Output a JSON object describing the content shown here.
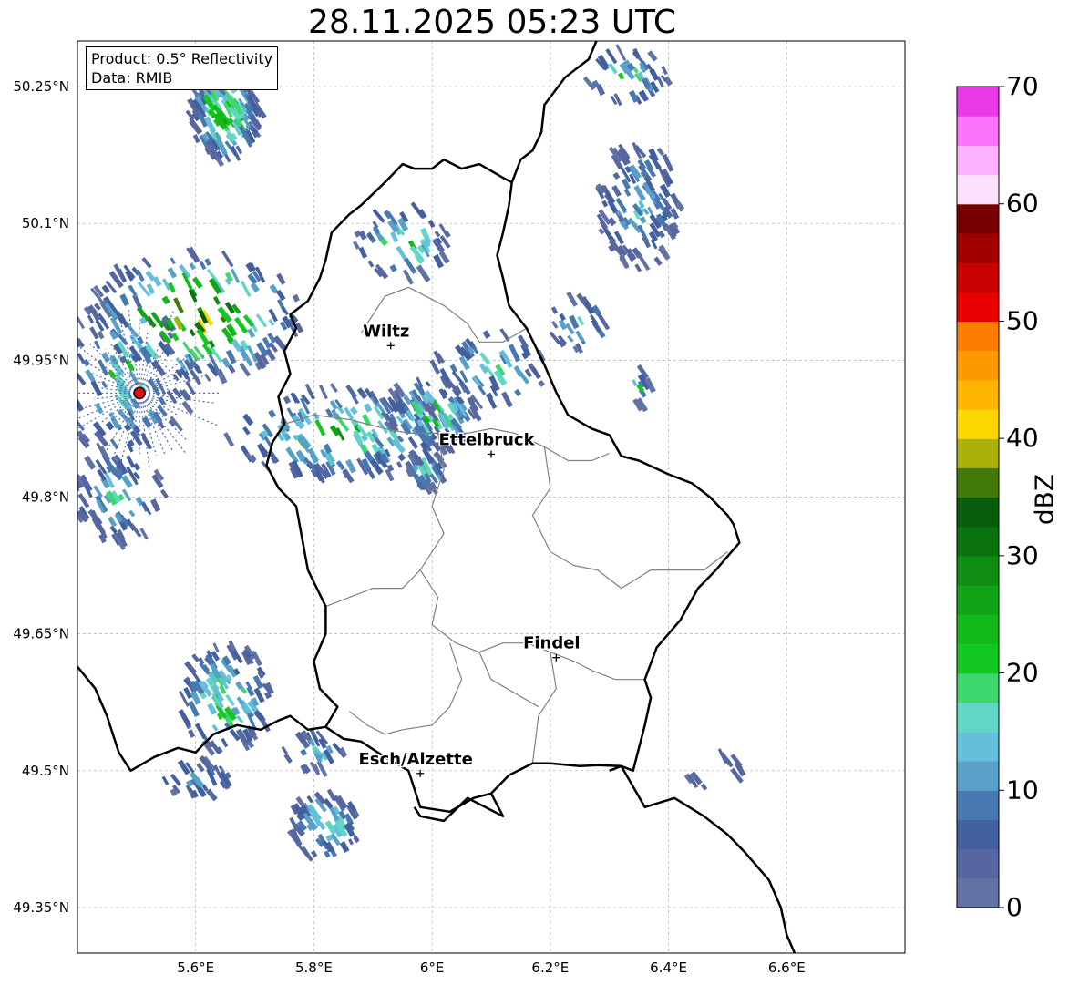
{
  "title": "28.11.2025 05:23 UTC",
  "info": {
    "product": "Product: 0.5° Reflectivity",
    "data_source": "Data: RMIB"
  },
  "colorbar": {
    "label": "dBZ",
    "tick_labels": [
      "0",
      "10",
      "20",
      "30",
      "40",
      "50",
      "60",
      "70"
    ],
    "min": 0,
    "max": 70,
    "step": 2.5,
    "colors": [
      "#6272a4",
      "#5566a0",
      "#43609e",
      "#4878b0",
      "#58a0c8",
      "#64c0da",
      "#60d6c4",
      "#3ed66e",
      "#12c820",
      "#12b818",
      "#10a416",
      "#0f8c12",
      "#0c7210",
      "#095c0c",
      "#427808",
      "#acb00a",
      "#fcd600",
      "#fcb400",
      "#fc9800",
      "#fc7c00",
      "#e80000",
      "#c80000",
      "#a00000",
      "#780000",
      "#fde0fd",
      "#fcb2fc",
      "#fa74fa",
      "#ea3ae8"
    ]
  },
  "axes": {
    "lon_range": [
      5.4,
      6.8
    ],
    "lat_range": [
      49.3,
      50.3
    ],
    "x_ticks": [
      {
        "value": 5.6,
        "label": "5.6°E"
      },
      {
        "value": 5.8,
        "label": "5.8°E"
      },
      {
        "value": 6.0,
        "label": "6°E"
      },
      {
        "value": 6.2,
        "label": "6.2°E"
      },
      {
        "value": 6.4,
        "label": "6.4°E"
      },
      {
        "value": 6.6,
        "label": "6.6°E"
      }
    ],
    "y_ticks": [
      {
        "value": 50.25,
        "label": "50.25°N"
      },
      {
        "value": 50.1,
        "label": "50.1°N"
      },
      {
        "value": 49.95,
        "label": "49.95°N"
      },
      {
        "value": 49.8,
        "label": "49.8°N"
      },
      {
        "value": 49.65,
        "label": "49.65°N"
      },
      {
        "value": 49.5,
        "label": "49.5°N"
      },
      {
        "value": 49.35,
        "label": "49.35°N"
      }
    ],
    "grid": true
  },
  "cities": [
    {
      "name": "Wiltz",
      "lon": 5.93,
      "lat": 49.966
    },
    {
      "name": "Ettelbruck",
      "lon": 6.1,
      "lat": 49.847
    },
    {
      "name": "Findel",
      "lon": 6.21,
      "lat": 49.624
    },
    {
      "name": "Esch/Alzette",
      "lon": 5.98,
      "lat": 49.497
    }
  ],
  "radar_site": {
    "lon": 5.505,
    "lat": 49.914,
    "color": "#e01010"
  },
  "echo_clusters": [
    {
      "lon": 5.65,
      "lat": 50.22,
      "rx": 0.06,
      "ry": 0.05,
      "n": 140,
      "maxdbz": 32
    },
    {
      "lon": 5.48,
      "lat": 49.93,
      "rx": 0.12,
      "ry": 0.09,
      "n": 120,
      "maxdbz": 20
    },
    {
      "lon": 5.6,
      "lat": 50.0,
      "rx": 0.18,
      "ry": 0.07,
      "n": 160,
      "maxdbz": 45
    },
    {
      "lon": 5.85,
      "lat": 49.87,
      "rx": 0.2,
      "ry": 0.05,
      "n": 170,
      "maxdbz": 26
    },
    {
      "lon": 6.0,
      "lat": 49.89,
      "rx": 0.08,
      "ry": 0.04,
      "n": 90,
      "maxdbz": 25
    },
    {
      "lon": 5.99,
      "lat": 49.83,
      "rx": 0.03,
      "ry": 0.02,
      "n": 40,
      "maxdbz": 22
    },
    {
      "lon": 6.35,
      "lat": 50.12,
      "rx": 0.07,
      "ry": 0.07,
      "n": 120,
      "maxdbz": 15
    },
    {
      "lon": 5.65,
      "lat": 49.58,
      "rx": 0.08,
      "ry": 0.06,
      "n": 110,
      "maxdbz": 26
    },
    {
      "lon": 5.82,
      "lat": 49.44,
      "rx": 0.06,
      "ry": 0.04,
      "n": 60,
      "maxdbz": 24
    },
    {
      "lon": 5.47,
      "lat": 49.8,
      "rx": 0.08,
      "ry": 0.05,
      "n": 70,
      "maxdbz": 16
    },
    {
      "lon": 5.95,
      "lat": 50.08,
      "rx": 0.08,
      "ry": 0.04,
      "n": 50,
      "maxdbz": 26
    },
    {
      "lon": 6.1,
      "lat": 49.94,
      "rx": 0.1,
      "ry": 0.04,
      "n": 50,
      "maxdbz": 20
    },
    {
      "lon": 6.33,
      "lat": 50.26,
      "rx": 0.07,
      "ry": 0.03,
      "n": 40,
      "maxdbz": 22
    },
    {
      "lon": 6.25,
      "lat": 49.99,
      "rx": 0.05,
      "ry": 0.03,
      "n": 25,
      "maxdbz": 17
    },
    {
      "lon": 5.8,
      "lat": 49.52,
      "rx": 0.05,
      "ry": 0.02,
      "n": 25,
      "maxdbz": 18
    },
    {
      "lon": 6.48,
      "lat": 49.5,
      "rx": 0.05,
      "ry": 0.02,
      "n": 12,
      "maxdbz": 12
    },
    {
      "lon": 5.6,
      "lat": 49.49,
      "rx": 0.06,
      "ry": 0.02,
      "n": 30,
      "maxdbz": 16
    },
    {
      "lon": 6.35,
      "lat": 49.92,
      "rx": 0.02,
      "ry": 0.02,
      "n": 10,
      "maxdbz": 20
    }
  ],
  "borders": {
    "national": [
      [
        [
          5.4,
          49.614
        ],
        [
          5.43,
          49.59
        ],
        [
          5.45,
          49.56
        ],
        [
          5.47,
          49.52
        ],
        [
          5.49,
          49.5
        ],
        [
          5.53,
          49.515
        ],
        [
          5.57,
          49.525
        ],
        [
          5.6,
          49.52
        ],
        [
          5.63,
          49.54
        ],
        [
          5.67,
          49.55
        ],
        [
          5.71,
          49.545
        ],
        [
          5.74,
          49.555
        ],
        [
          5.76,
          49.56
        ],
        [
          5.79,
          49.545
        ],
        [
          5.82,
          49.548
        ],
        [
          5.85,
          49.535
        ],
        [
          5.88,
          49.532
        ],
        [
          5.92,
          49.515
        ],
        [
          5.96,
          49.5
        ],
        [
          5.98,
          49.46
        ],
        [
          6.03,
          49.455
        ],
        [
          6.07,
          49.47
        ],
        [
          6.1,
          49.475
        ],
        [
          6.13,
          49.495
        ],
        [
          6.17,
          49.508
        ],
        [
          6.2,
          49.508
        ],
        [
          6.25,
          49.505
        ],
        [
          6.28,
          49.506
        ],
        [
          6.32,
          49.505
        ],
        [
          6.36,
          49.46
        ],
        [
          6.41,
          49.47
        ],
        [
          6.46,
          49.45
        ],
        [
          6.5,
          49.43
        ],
        [
          6.53,
          49.41
        ],
        [
          6.57,
          49.38
        ],
        [
          6.59,
          49.35
        ],
        [
          6.6,
          49.32
        ],
        [
          6.62,
          49.29
        ]
      ],
      [
        [
          6.28,
          50.303
        ],
        [
          6.265,
          50.28
        ],
        [
          6.225,
          50.26
        ],
        [
          6.19,
          50.23
        ],
        [
          6.185,
          50.2
        ],
        [
          6.17,
          50.18
        ],
        [
          6.15,
          50.17
        ],
        [
          6.135,
          50.145
        ],
        [
          6.13,
          50.12
        ],
        [
          6.12,
          50.09
        ],
        [
          6.11,
          50.065
        ],
        [
          6.12,
          50.04
        ],
        [
          6.13,
          50.01
        ],
        [
          6.16,
          49.985
        ],
        [
          6.19,
          49.945
        ],
        [
          6.21,
          49.915
        ],
        [
          6.23,
          49.89
        ],
        [
          6.27,
          49.875
        ],
        [
          6.3,
          49.868
        ],
        [
          6.32,
          49.845
        ],
        [
          6.35,
          49.84
        ],
        [
          6.4,
          49.825
        ],
        [
          6.44,
          49.815
        ],
        [
          6.47,
          49.8
        ],
        [
          6.5,
          49.78
        ],
        [
          6.51,
          49.77
        ],
        [
          6.52,
          49.75
        ],
        [
          6.5,
          49.735
        ],
        [
          6.48,
          49.72
        ],
        [
          6.45,
          49.7
        ],
        [
          6.42,
          49.665
        ],
        [
          6.38,
          49.635
        ],
        [
          6.36,
          49.6
        ],
        [
          6.37,
          49.58
        ],
        [
          6.36,
          49.55
        ],
        [
          6.35,
          49.525
        ],
        [
          6.34,
          49.5
        ],
        [
          6.32,
          49.505
        ],
        [
          6.3,
          49.5
        ]
      ],
      [
        [
          6.1,
          49.475
        ],
        [
          6.12,
          49.45
        ],
        [
          6.06,
          49.47
        ],
        [
          6.02,
          49.445
        ],
        [
          5.98,
          49.45
        ],
        [
          5.97,
          49.46
        ]
      ]
    ],
    "luxembourg": [
      [
        [
          5.82,
          49.548
        ],
        [
          5.84,
          49.57
        ],
        [
          5.81,
          49.59
        ],
        [
          5.8,
          49.62
        ],
        [
          5.82,
          49.65
        ],
        [
          5.82,
          49.68
        ],
        [
          5.79,
          49.72
        ],
        [
          5.77,
          49.79
        ],
        [
          5.74,
          49.81
        ],
        [
          5.72,
          49.835
        ],
        [
          5.73,
          49.86
        ],
        [
          5.75,
          49.88
        ],
        [
          5.74,
          49.91
        ],
        [
          5.76,
          49.935
        ],
        [
          5.75,
          49.96
        ],
        [
          5.77,
          49.985
        ],
        [
          5.76,
          50.0
        ],
        [
          5.79,
          50.015
        ],
        [
          5.81,
          50.04
        ],
        [
          5.82,
          50.06
        ],
        [
          5.83,
          50.09
        ],
        [
          5.86,
          50.11
        ],
        [
          5.88,
          50.12
        ],
        [
          5.92,
          50.145
        ],
        [
          5.95,
          50.165
        ],
        [
          5.97,
          50.16
        ],
        [
          6.0,
          50.16
        ],
        [
          6.02,
          50.17
        ],
        [
          6.05,
          50.16
        ],
        [
          6.08,
          50.165
        ],
        [
          6.12,
          50.15
        ],
        [
          6.135,
          50.145
        ]
      ]
    ],
    "cantons": [
      [
        [
          5.88,
          49.98
        ],
        [
          5.92,
          50.02
        ],
        [
          5.96,
          50.03
        ],
        [
          6.02,
          50.01
        ],
        [
          6.06,
          49.99
        ],
        [
          6.08,
          49.97
        ],
        [
          6.12,
          49.97
        ],
        [
          6.16,
          49.985
        ]
      ],
      [
        [
          5.75,
          49.88
        ],
        [
          5.8,
          49.89
        ],
        [
          5.86,
          49.885
        ],
        [
          5.92,
          49.875
        ],
        [
          5.96,
          49.87
        ],
        [
          6.01,
          49.87
        ],
        [
          6.06,
          49.87
        ],
        [
          6.1,
          49.875
        ],
        [
          6.14,
          49.87
        ],
        [
          6.19,
          49.855
        ],
        [
          6.23,
          49.84
        ],
        [
          6.27,
          49.84
        ],
        [
          6.3,
          49.848
        ]
      ],
      [
        [
          6.01,
          49.87
        ],
        [
          6.02,
          49.83
        ],
        [
          6.0,
          49.79
        ],
        [
          6.02,
          49.76
        ],
        [
          5.98,
          49.72
        ],
        [
          6.01,
          49.69
        ],
        [
          6.0,
          49.66
        ],
        [
          6.04,
          49.64
        ],
        [
          6.08,
          49.63
        ],
        [
          6.12,
          49.64
        ],
        [
          6.16,
          49.64
        ],
        [
          6.2,
          49.63
        ],
        [
          6.24,
          49.62
        ],
        [
          6.27,
          49.61
        ],
        [
          6.31,
          49.6
        ],
        [
          6.36,
          49.6
        ]
      ],
      [
        [
          6.19,
          49.855
        ],
        [
          6.2,
          49.81
        ],
        [
          6.17,
          49.78
        ],
        [
          6.2,
          49.74
        ],
        [
          6.24,
          49.725
        ],
        [
          6.28,
          49.72
        ],
        [
          6.32,
          49.7
        ],
        [
          6.37,
          49.72
        ],
        [
          6.42,
          49.72
        ],
        [
          6.46,
          49.72
        ],
        [
          6.5,
          49.74
        ]
      ],
      [
        [
          5.82,
          49.68
        ],
        [
          5.86,
          49.69
        ],
        [
          5.9,
          49.7
        ],
        [
          5.95,
          49.7
        ],
        [
          5.98,
          49.72
        ]
      ],
      [
        [
          6.03,
          49.64
        ],
        [
          6.05,
          49.6
        ],
        [
          6.03,
          49.57
        ],
        [
          6.0,
          49.55
        ],
        [
          5.95,
          49.545
        ],
        [
          5.92,
          49.54
        ],
        [
          5.89,
          49.55
        ],
        [
          5.86,
          49.565
        ]
      ],
      [
        [
          6.2,
          49.63
        ],
        [
          6.21,
          49.59
        ],
        [
          6.18,
          49.56
        ],
        [
          6.17,
          49.508
        ]
      ],
      [
        [
          6.08,
          49.63
        ],
        [
          6.1,
          49.6
        ],
        [
          6.14,
          49.585
        ],
        [
          6.18,
          49.57
        ]
      ]
    ]
  }
}
